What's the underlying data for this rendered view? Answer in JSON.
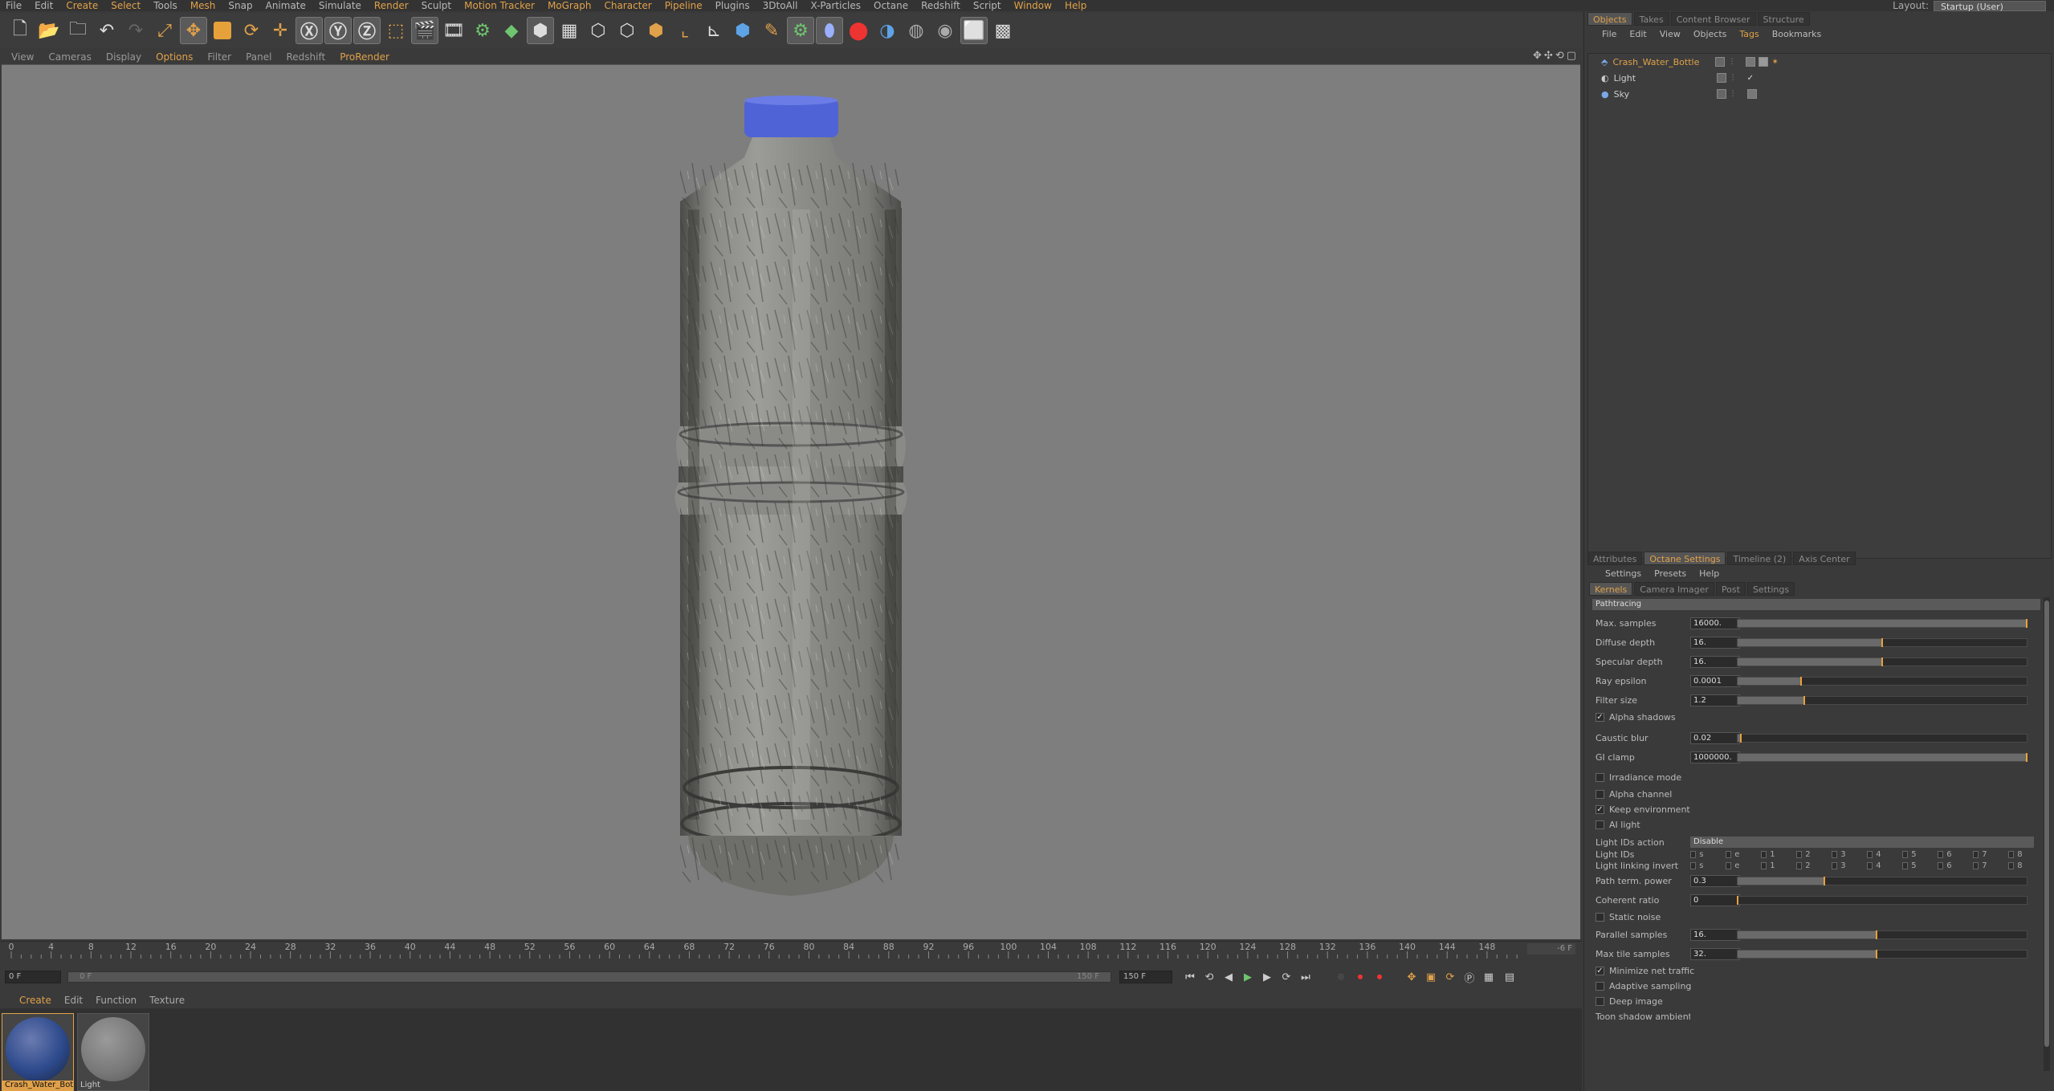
{
  "menu": [
    "File",
    "Edit",
    "Create",
    "Select",
    "Tools",
    "Mesh",
    "Snap",
    "Animate",
    "Simulate",
    "Render",
    "Sculpt",
    "Motion Tracker",
    "MoGraph",
    "Character",
    "Pipeline",
    "Plugins",
    "3DtoAll",
    "X-Particles",
    "Octane",
    "Redshift",
    "Script",
    "Window",
    "Help"
  ],
  "layout": {
    "label": "Layout:",
    "value": "Startup (User)"
  },
  "viewport_menu": [
    "View",
    "Cameras",
    "Display",
    "Options",
    "Filter",
    "Panel",
    "Redshift",
    "ProRender"
  ],
  "viewport_nav_icons": [
    "move-view-icon",
    "scroll-view-icon",
    "rotate-view-icon",
    "maximize-view-icon"
  ],
  "timeline": {
    "ticks": [
      "0",
      "4",
      "8",
      "12",
      "16",
      "20",
      "24",
      "28",
      "32",
      "36",
      "40",
      "44",
      "48",
      "52",
      "56",
      "60",
      "64",
      "68",
      "72",
      "76",
      "80",
      "84",
      "88",
      "92",
      "96",
      "100",
      "104",
      "108",
      "112",
      "116",
      "120",
      "124",
      "128",
      "132",
      "136",
      "140",
      "144",
      "148"
    ],
    "current_frame_readout": "-6 F",
    "start": "0 F",
    "range_start": "0 F",
    "range_end": "150 F",
    "end": "150 F"
  },
  "materials_menu": [
    "Create",
    "Edit",
    "Function",
    "Texture"
  ],
  "materials": [
    {
      "name": "Crash_Water_Bot",
      "color": "#2d4a8c"
    },
    {
      "name": "Light",
      "color": "#8a8a8a"
    }
  ],
  "right_tabs_top": [
    "Objects",
    "Takes",
    "Content Browser",
    "Structure"
  ],
  "objects_menu": [
    "File",
    "Edit",
    "View",
    "Objects",
    "Tags",
    "Bookmarks"
  ],
  "objects": [
    {
      "name": "Crash_Water_Bottle",
      "highlighted": true
    },
    {
      "name": "Light",
      "highlighted": false
    },
    {
      "name": "Sky",
      "highlighted": false
    }
  ],
  "right_tabs_bottom": [
    "Attributes",
    "Octane Settings",
    "Timeline (2)",
    "Axis Center"
  ],
  "octane_menu": [
    "Settings",
    "Presets",
    "Help"
  ],
  "octane_subtabs": [
    "Kernels",
    "Camera Imager",
    "Post",
    "Settings"
  ],
  "kernel": "Pathtracing",
  "settings": {
    "max_samples": {
      "label": "Max. samples",
      "value": "16000.",
      "fraction": 1.0
    },
    "diffuse_depth": {
      "label": "Diffuse depth",
      "value": "16.",
      "fraction": 0.5
    },
    "specular_depth": {
      "label": "Specular depth",
      "value": "16.",
      "fraction": 0.5
    },
    "ray_epsilon": {
      "label": "Ray epsilon",
      "value": "0.0001",
      "fraction": 0.22
    },
    "filter_size": {
      "label": "Filter size",
      "value": "1.2",
      "fraction": 0.23
    },
    "alpha_shadows": {
      "label": "Alpha shadows",
      "checked": true
    },
    "caustic_blur": {
      "label": "Caustic blur",
      "value": "0.02",
      "fraction": 0.01
    },
    "gi_clamp": {
      "label": "GI clamp",
      "value": "1000000.",
      "fraction": 1.0
    },
    "irradiance_mode": {
      "label": "Irradiance mode",
      "checked": false
    },
    "alpha_channel": {
      "label": "Alpha channel",
      "checked": false
    },
    "keep_environment": {
      "label": "Keep environment",
      "checked": true
    },
    "ai_light": {
      "label": "AI light",
      "checked": false
    },
    "light_ids_action": {
      "label": "Light IDs action",
      "value": "Disable"
    },
    "light_ids": {
      "label": "Light IDs",
      "items": [
        "s",
        "e",
        "1",
        "2",
        "3",
        "4",
        "5",
        "6",
        "7",
        "8"
      ]
    },
    "light_linking_invert": {
      "label": "Light linking invert",
      "items": [
        "s",
        "e",
        "1",
        "2",
        "3",
        "4",
        "5",
        "6",
        "7",
        "8"
      ]
    },
    "path_term_power": {
      "label": "Path term. power",
      "value": "0.3",
      "fraction": 0.3
    },
    "coherent_ratio": {
      "label": "Coherent ratio",
      "value": "0",
      "fraction": 0.0
    },
    "static_noise": {
      "label": "Static noise",
      "checked": false
    },
    "parallel_samples": {
      "label": "Parallel samples",
      "value": "16.",
      "fraction": 0.48
    },
    "max_tile_samples": {
      "label": "Max tile samples",
      "value": "32.",
      "fraction": 0.48
    },
    "minimize_net_traffic": {
      "label": "Minimize net traffic",
      "checked": true
    },
    "adaptive_sampling": {
      "label": "Adaptive sampling",
      "checked": false
    },
    "deep_image": {
      "label": "Deep image",
      "checked": false
    },
    "toon_shadow_ambient": {
      "label": "Toon shadow ambient"
    }
  },
  "colors": {
    "accent": "#e0a14a",
    "viewport_bg": "#7e7e7e",
    "cap_blue": "#4f63d6"
  }
}
